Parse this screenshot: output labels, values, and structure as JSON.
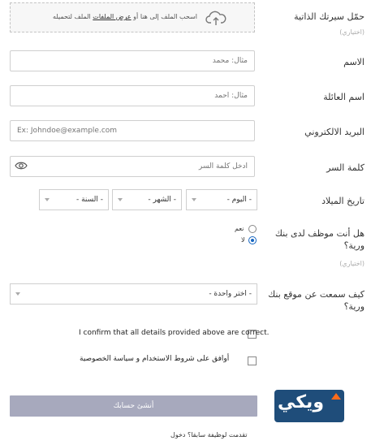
{
  "fields": {
    "cv": {
      "label": "حمّل سيرتك الذاتية",
      "hint": "(اختياري)",
      "upload_text_before": "اسحب الملف إلى هنا أو ",
      "upload_link": "عرض الملفات",
      "upload_text_after": " الملف لتحميله"
    },
    "first_name": {
      "label": "الاسم",
      "placeholder": "مثال: محمد"
    },
    "last_name": {
      "label": "اسم العائلة",
      "placeholder": "مثال: أحمد"
    },
    "email": {
      "label": "البريد الالكتروني",
      "placeholder": "Ex: Johndoe@example.com"
    },
    "password": {
      "label": "كلمة السر",
      "placeholder": "أدخل كلمة السر"
    },
    "birth_date": {
      "label": "تاريخ الميلاد",
      "day": "- اليوم -",
      "month": "- الشهر -",
      "year": "- السنة -"
    },
    "employee": {
      "label": "هل أنت موظف لدى بنك ورية؟",
      "hint": "(اختياري)",
      "yes": "نعم",
      "no": "لا"
    },
    "source": {
      "label": "كيف سمعت عن موقع بنك ورية؟",
      "value": "- اختر واحدة -"
    },
    "confirm": {
      "label": "I confirm that all details provided above are correct."
    },
    "terms": {
      "label": "أوافق على شروط الاستخدام و سياسة الخصوصية"
    }
  },
  "submit_label": "أنشئ حسابك",
  "bottom_link": "تقدمت لوظيفة سابقا؟ دخول",
  "logo_text": "ويكي",
  "colors": {
    "submit_bg": "#a7a9bd",
    "radio_on": "#1565c0",
    "logo_bg": "#1f4d7a",
    "logo_accent": "#ff6b1a"
  },
  "icons": {
    "upload": "cloud-upload-icon",
    "password_toggle": "eye-icon",
    "caret": "chevron-down-icon"
  }
}
